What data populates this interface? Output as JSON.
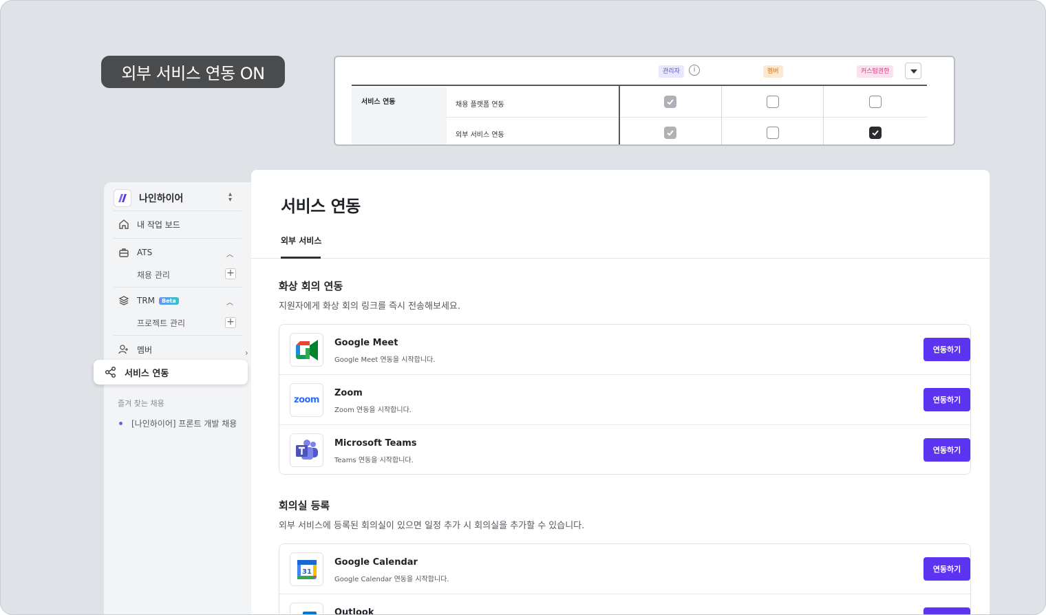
{
  "headline": "외부 서비스 연동 ON",
  "permissions": {
    "roles": [
      "관리자",
      "멤버",
      "커스텀권한"
    ],
    "category": "서비스 연동",
    "rows": [
      {
        "label": "채용 플랫폼 연동",
        "checks": [
          "disabled-checked",
          "unchecked",
          "unchecked"
        ]
      },
      {
        "label": "외부 서비스 연동",
        "checks": [
          "disabled-checked",
          "unchecked",
          "checked"
        ]
      }
    ]
  },
  "sidebar": {
    "workspace": "나인하이어",
    "my_board": "내 작업 보드",
    "ats": "ATS",
    "ats_sub": "채용 관리",
    "trm": "TRM",
    "trm_badge": "Beta",
    "trm_sub": "프로젝트 관리",
    "member": "멤버",
    "service": "서비스 연동",
    "favorites_title": "즐겨 찾는 채용",
    "favorite_item": "[나인하이어] 프론트 개발 채용"
  },
  "main": {
    "title": "서비스 연동",
    "tab": "외부 서비스",
    "section1": {
      "title": "화상 회의 연동",
      "desc": "지원자에게 화상 회의 링크를 즉시 전송해보세요."
    },
    "section2": {
      "title": "회의실 등록",
      "desc": "외부 서비스에 등록된 회의실이 있으면 일정 추가 시 회의실을 추가할 수 있습니다."
    },
    "button_label": "연동하기",
    "services": [
      {
        "name": "Google Meet",
        "desc": "Google Meet 연동을 시작합니다."
      },
      {
        "name": "Zoom",
        "desc": "Zoom 연동을 시작합니다.",
        "logo_text": "zoom"
      },
      {
        "name": "Microsoft Teams",
        "desc": "Teams 연동을 시작합니다."
      },
      {
        "name": "Google Calendar",
        "desc": "Google Calendar 연동을 시작합니다.",
        "logo_text": "31"
      },
      {
        "name": "Outlook",
        "desc": ""
      }
    ]
  },
  "colors": {
    "primary": "#5b33f0",
    "admin_tag": "#5a4fd6",
    "member_tag": "#d6731a",
    "custom_tag": "#d23a7d"
  }
}
